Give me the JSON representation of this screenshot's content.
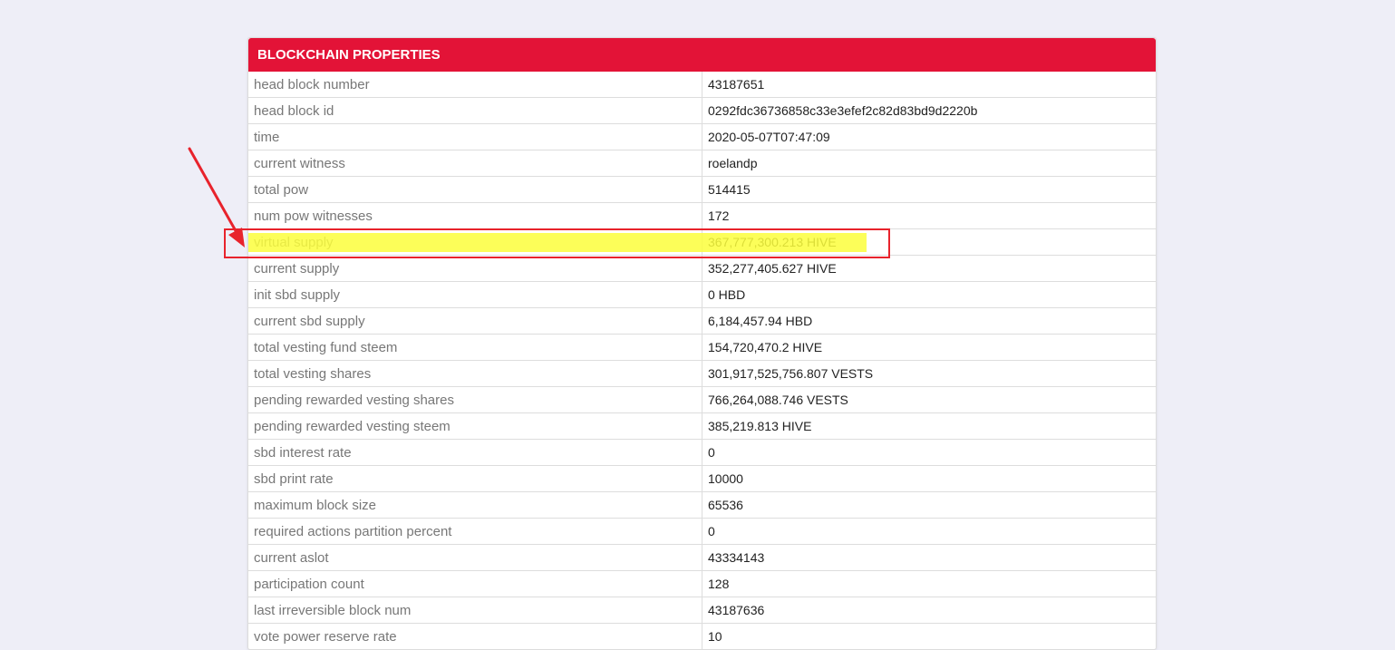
{
  "panel": {
    "title": "BLOCKCHAIN PROPERTIES"
  },
  "rows": [
    {
      "key": "head block number",
      "value": "43187651"
    },
    {
      "key": "head block id",
      "value": "0292fdc36736858c33e3efef2c82d83bd9d2220b"
    },
    {
      "key": "time",
      "value": "2020-05-07T07:47:09"
    },
    {
      "key": "current witness",
      "value": "roelandp"
    },
    {
      "key": "total pow",
      "value": "514415"
    },
    {
      "key": "num pow witnesses",
      "value": "172"
    },
    {
      "key": "virtual supply",
      "value": "367,777,300.213 HIVE"
    },
    {
      "key": "current supply",
      "value": "352,277,405.627 HIVE"
    },
    {
      "key": "init sbd supply",
      "value": "0 HBD"
    },
    {
      "key": "current sbd supply",
      "value": "6,184,457.94 HBD"
    },
    {
      "key": "total vesting fund steem",
      "value": "154,720,470.2 HIVE"
    },
    {
      "key": "total vesting shares",
      "value": "301,917,525,756.807 VESTS"
    },
    {
      "key": "pending rewarded vesting shares",
      "value": "766,264,088.746 VESTS"
    },
    {
      "key": "pending rewarded vesting steem",
      "value": "385,219.813 HIVE"
    },
    {
      "key": "sbd interest rate",
      "value": "0"
    },
    {
      "key": "sbd print rate",
      "value": "10000"
    },
    {
      "key": "maximum block size",
      "value": "65536"
    },
    {
      "key": "required actions partition percent",
      "value": "0"
    },
    {
      "key": "current aslot",
      "value": "43334143"
    },
    {
      "key": "participation count",
      "value": "128"
    },
    {
      "key": "last irreversible block num",
      "value": "43187636"
    },
    {
      "key": "vote power reserve rate",
      "value": "10"
    }
  ],
  "colors": {
    "header": "#e31337",
    "highlight": "#fbfe3c",
    "annotation": "#e8232c",
    "background": "#eeeef7"
  }
}
